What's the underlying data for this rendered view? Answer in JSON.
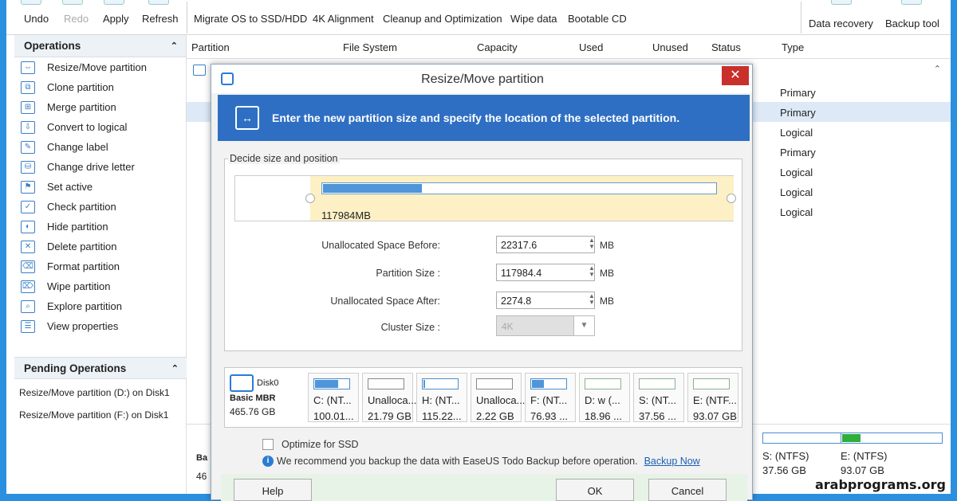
{
  "toolbar": {
    "undo": "Undo",
    "redo": "Redo",
    "apply": "Apply",
    "refresh": "Refresh",
    "migrate": "Migrate OS to SSD/HDD",
    "alignment": "4K Alignment",
    "cleanup": "Cleanup and Optimization",
    "wipe": "Wipe data",
    "bootable": "Bootable CD",
    "recovery": "Data recovery",
    "backup": "Backup tool"
  },
  "operations": {
    "title": "Operations",
    "items": [
      {
        "label": "Resize/Move partition",
        "icon": "resize-icon"
      },
      {
        "label": "Clone partition",
        "icon": "clone-icon"
      },
      {
        "label": "Merge partition",
        "icon": "merge-icon"
      },
      {
        "label": "Convert to logical",
        "icon": "convert-icon"
      },
      {
        "label": "Change label",
        "icon": "label-icon"
      },
      {
        "label": "Change drive letter",
        "icon": "drive-letter-icon"
      },
      {
        "label": "Set active",
        "icon": "flag-icon"
      },
      {
        "label": "Check partition",
        "icon": "check-icon"
      },
      {
        "label": "Hide partition",
        "icon": "hide-icon"
      },
      {
        "label": "Delete partition",
        "icon": "delete-icon"
      },
      {
        "label": "Format partition",
        "icon": "format-icon"
      },
      {
        "label": "Wipe partition",
        "icon": "eraser-icon"
      },
      {
        "label": "Explore partition",
        "icon": "explore-icon"
      },
      {
        "label": "View properties",
        "icon": "properties-icon"
      }
    ]
  },
  "pending": {
    "title": "Pending Operations",
    "items": [
      "Resize/Move partition (D:) on Disk1",
      "Resize/Move partition (F:) on Disk1"
    ]
  },
  "columns": {
    "partition": "Partition",
    "filesystem": "File System",
    "capacity": "Capacity",
    "used": "Used",
    "unused": "Unused",
    "status": "Status",
    "type": "Type"
  },
  "table_types": [
    "Primary",
    "Primary",
    "Logical",
    "Primary",
    "Logical",
    "Logical",
    "Logical"
  ],
  "dialog": {
    "title": "Resize/Move partition",
    "close": "✕",
    "banner": "Enter the new partition size and specify the location of the selected partition.",
    "group_label": "Decide size and position",
    "partition_size_text": "117984MB",
    "partition_fill": 0.25,
    "fields": {
      "before_label": "Unallocated Space Before:",
      "before_value": "22317.6",
      "size_label": "Partition Size :",
      "size_value": "117984.4",
      "after_label": "Unallocated Space After:",
      "after_value": "2274.8",
      "cluster_label": "Cluster Size :",
      "cluster_value": "4K",
      "unit": "MB"
    },
    "disk": {
      "name": "Disk0",
      "kind": "Basic MBR",
      "size": "465.76 GB",
      "parts": [
        {
          "l1": "C: (NT...",
          "l2": "100.01...",
          "fill": 0.7,
          "unalloc": false
        },
        {
          "l1": "Unalloca...",
          "l2": "21.79 GB",
          "fill": 0,
          "unalloc": true
        },
        {
          "l1": "H: (NT...",
          "l2": "115.22...",
          "fill": 0.05,
          "unalloc": false
        },
        {
          "l1": "Unalloca...",
          "l2": "2.22 GB",
          "fill": 0,
          "unalloc": true
        },
        {
          "l1": "F: (NT...",
          "l2": "76.93 ...",
          "fill": 0.35,
          "unalloc": false
        },
        {
          "l1": "D: w (...",
          "l2": "18.96 ...",
          "fill": 0,
          "unalloc": false
        },
        {
          "l1": "S: (NT...",
          "l2": "37.56 ...",
          "fill": 0,
          "unalloc": false
        },
        {
          "l1": "E: (NTF...",
          "l2": "93.07 GB",
          "fill": 0,
          "unalloc": false
        }
      ]
    },
    "optimize": "Optimize for SSD",
    "tip": "We recommend you backup the data with EaseUS Todo Backup before operation.",
    "tip_link": "Backup Now",
    "help": "Help",
    "ok": "OK",
    "cancel": "Cancel"
  },
  "bottom": {
    "left_partial_1": "Ba",
    "left_partial_2": "46",
    "s_part": {
      "l1": "S: (NTFS)",
      "l2": "37.56 GB",
      "fill": 0
    },
    "e_part": {
      "l1": "E: (NTFS)",
      "l2": "93.07 GB",
      "fill": 0.18
    }
  },
  "watermark": "arabprograms.org",
  "colors": {
    "accent": "#2e6fc4",
    "frame": "#2b8fe0",
    "close": "#c9302c"
  }
}
